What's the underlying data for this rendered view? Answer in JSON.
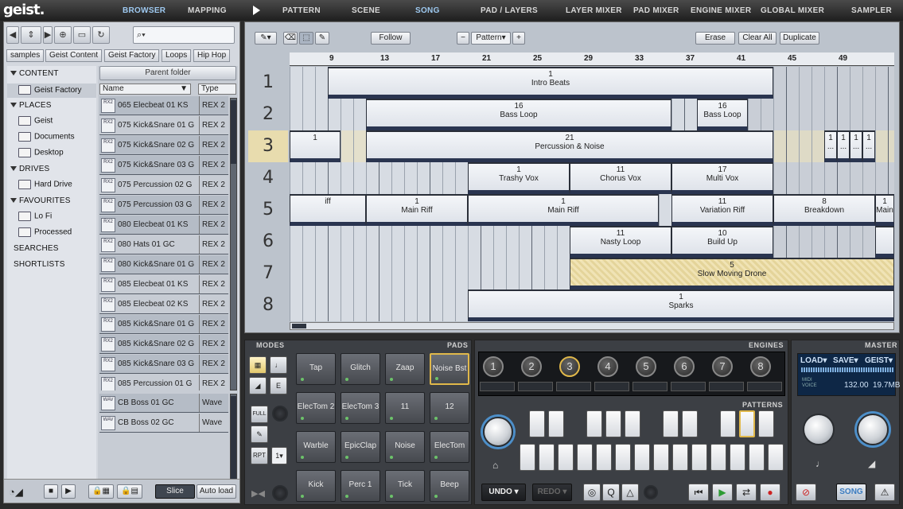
{
  "app": {
    "logo": "geist."
  },
  "top_tabs": [
    {
      "label": "BROWSER",
      "active": true
    },
    {
      "label": "MAPPING"
    },
    {
      "label": "PATTERN"
    },
    {
      "label": "SCENE"
    },
    {
      "label": "SONG",
      "active": true
    },
    {
      "label": "PAD / LAYERS"
    },
    {
      "label": "LAYER MIXER"
    },
    {
      "label": "PAD MIXER"
    },
    {
      "label": "ENGINE MIXER"
    },
    {
      "label": "GLOBAL MIXER"
    },
    {
      "label": "SAMPLER"
    }
  ],
  "browser": {
    "breadcrumb": [
      "samples",
      "Geist Content",
      "Geist Factory",
      "Loops",
      "Hip Hop"
    ],
    "tree": {
      "content": "CONTENT",
      "geist_factory": "Geist Factory",
      "places": "PLACES",
      "place_items": [
        "Geist",
        "Documents",
        "Desktop"
      ],
      "drives": "DRIVES",
      "drive_items": [
        "Hard Drive"
      ],
      "favourites": "FAVOURITES",
      "favourite_items": [
        "Lo Fi",
        "Processed"
      ],
      "searches": "SEARCHES",
      "shortlists": "SHORTLISTS"
    },
    "parent_folder": "Parent folder",
    "col_name": "Name",
    "col_type": "Type",
    "files": [
      {
        "name": "065 Elecbeat 01 KS",
        "type": "REX 2",
        "icon": "RX2"
      },
      {
        "name": "075 Kick&Snare 01 G",
        "type": "REX 2",
        "icon": "RX2"
      },
      {
        "name": "075 Kick&Snare 02 G",
        "type": "REX 2",
        "icon": "RX2"
      },
      {
        "name": "075 Kick&Snare 03 G",
        "type": "REX 2",
        "icon": "RX2"
      },
      {
        "name": "075 Percussion 02 G",
        "type": "REX 2",
        "icon": "RX2"
      },
      {
        "name": "075 Percussion 03 G",
        "type": "REX 2",
        "icon": "RX2"
      },
      {
        "name": "080 Elecbeat 01 KS",
        "type": "REX 2",
        "icon": "RX2"
      },
      {
        "name": "080 Hats 01 GC",
        "type": "REX 2",
        "icon": "RX2"
      },
      {
        "name": "080 Kick&Snare 01 G",
        "type": "REX 2",
        "icon": "RX2"
      },
      {
        "name": "085 Elecbeat 01 KS",
        "type": "REX 2",
        "icon": "RX2"
      },
      {
        "name": "085 Elecbeat 02 KS",
        "type": "REX 2",
        "icon": "RX2"
      },
      {
        "name": "085 Kick&Snare 01 G",
        "type": "REX 2",
        "icon": "RX2"
      },
      {
        "name": "085 Kick&Snare 02 G",
        "type": "REX 2",
        "icon": "RX2"
      },
      {
        "name": "085 Kick&Snare 03 G",
        "type": "REX 2",
        "icon": "RX2"
      },
      {
        "name": "085 Percussion 01 G",
        "type": "REX 2",
        "icon": "RX2"
      }
    ],
    "shortlist": [
      {
        "name": "CB Boss 01 GC",
        "type": "Wave",
        "icon": "WAV"
      },
      {
        "name": "CB Boss 02 GC",
        "type": "Wave",
        "icon": "WAV"
      }
    ],
    "slice_button": "Slice",
    "autoload_button": "Auto load"
  },
  "song": {
    "follow": "Follow",
    "pattern_select": "Pattern",
    "minus": "−",
    "plus": "+",
    "erase": "Erase",
    "clear_all": "Clear All",
    "duplicate": "Duplicate",
    "ruler": [
      "9",
      "13",
      "17",
      "21",
      "25",
      "29",
      "33",
      "37",
      "41",
      "45",
      "49"
    ],
    "lanes": [
      "1",
      "2",
      "3",
      "4",
      "5",
      "6",
      "7",
      "8"
    ],
    "clips": [
      {
        "lane": 0,
        "start": 0,
        "len": 35,
        "num": "1",
        "title": "Intro Beats"
      },
      {
        "lane": 1,
        "start": 3,
        "len": 24,
        "num": "16",
        "title": "Bass Loop"
      },
      {
        "lane": 1,
        "start": 29,
        "len": 4,
        "num": "16",
        "title": "Bass Loop"
      },
      {
        "lane": 2,
        "start": -3,
        "len": 4,
        "num": "",
        "title": "1"
      },
      {
        "lane": 2,
        "start": 3,
        "len": 32,
        "num": "21",
        "title": "Percussion & Noise"
      },
      {
        "lane": 2,
        "start": 39,
        "len": 1,
        "num": "1",
        "title": "..."
      },
      {
        "lane": 2,
        "start": 40,
        "len": 1,
        "num": "1",
        "title": "..."
      },
      {
        "lane": 2,
        "start": 41,
        "len": 1,
        "num": "1",
        "title": "..."
      },
      {
        "lane": 2,
        "start": 42,
        "len": 1,
        "num": "1",
        "title": "..."
      },
      {
        "lane": 3,
        "start": 11,
        "len": 8,
        "num": "1",
        "title": "Trashy Vox"
      },
      {
        "lane": 3,
        "start": 19,
        "len": 8,
        "num": "11",
        "title": "Chorus Vox"
      },
      {
        "lane": 3,
        "start": 27,
        "len": 8,
        "num": "17",
        "title": "Multi Vox"
      },
      {
        "lane": 4,
        "start": -3,
        "len": 6,
        "num": "",
        "title": "iff"
      },
      {
        "lane": 4,
        "start": 3,
        "len": 8,
        "num": "1",
        "title": "Main Riff"
      },
      {
        "lane": 4,
        "start": 11,
        "len": 15,
        "num": "1",
        "title": "Main Riff"
      },
      {
        "lane": 4,
        "start": 27,
        "len": 8,
        "num": "11",
        "title": "Variation Riff"
      },
      {
        "lane": 4,
        "start": 35,
        "len": 8,
        "num": "8",
        "title": "Breakdown"
      },
      {
        "lane": 4,
        "start": 43,
        "len": 5,
        "num": "1",
        "title": "Main"
      },
      {
        "lane": 5,
        "start": 19,
        "len": 8,
        "num": "11",
        "title": "Nasty Loop"
      },
      {
        "lane": 5,
        "start": 27,
        "len": 8,
        "num": "10",
        "title": "Build Up"
      },
      {
        "lane": 5,
        "start": 43,
        "len": 5,
        "num": "",
        "title": ""
      },
      {
        "lane": 6,
        "start": 19,
        "len": 29,
        "num": "5",
        "title": "Slow Moving Drone",
        "hatch": true
      },
      {
        "lane": 7,
        "start": 11,
        "len": 37,
        "num": "1",
        "title": "Sparks"
      }
    ]
  },
  "modes": {
    "title": "MODES",
    "full": "FULL",
    "rpt": "RPT",
    "rpt_value": "1"
  },
  "pads": {
    "title": "PADS",
    "items": [
      "Tap",
      "Glitch",
      "Zaap",
      "Noise Bst",
      "ElecTom 2",
      "ElecTom 3",
      "11",
      "12",
      "Warble",
      "EpicClap",
      "Noise",
      "ElecTom",
      "Kick",
      "Perc 1",
      "Tick",
      "Beep"
    ]
  },
  "engines": {
    "title": "ENGINES",
    "items": [
      "1",
      "2",
      "3",
      "4",
      "5",
      "6",
      "7",
      "8"
    ],
    "patterns_title": "PATTERNS"
  },
  "master": {
    "title": "MASTER",
    "load": "LOAD",
    "save": "SAVE",
    "geist": "GEIST",
    "midi": "MIDI",
    "voice": "VOICE",
    "bpm": "132.00",
    "mem": "19.7MB"
  },
  "transport": {
    "undo": "UNDO",
    "redo": "REDO",
    "song": "SONG"
  }
}
